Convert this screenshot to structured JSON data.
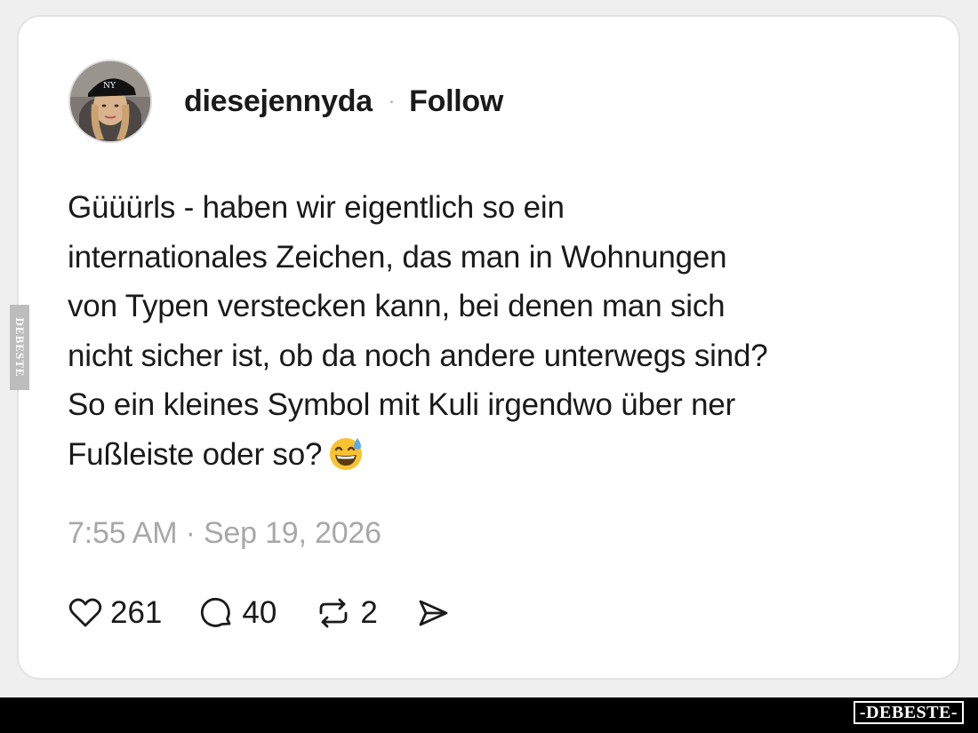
{
  "post": {
    "username": "diesejennyda",
    "separator": "·",
    "follow_label": "Follow",
    "text_lines": [
      "Güüürls - haben wir eigentlich so ein",
      "internationales Zeichen, das man in Wohnungen",
      "von Typen verstecken kann, bei denen man sich",
      "nicht sicher ist, ob da noch andere unterwegs sind?",
      "So ein kleines Symbol mit Kuli irgendwo über ner",
      "Fußleiste oder so?"
    ],
    "emoji": "grinning-face-with-sweat",
    "timestamp": "7:55 AM · Sep 19, 2026",
    "likes": "261",
    "comments": "40",
    "reposts": "2"
  },
  "icons": {
    "like": "heart-icon",
    "comment": "comment-bubble-icon",
    "repost": "repost-icon",
    "share": "send-icon"
  },
  "watermark": {
    "bottom": "-DEBESTE-",
    "side": "DEBESTE"
  },
  "colors": {
    "text": "#1a1a1a",
    "muted": "#a8a8a8",
    "background": "#efefef",
    "card": "#ffffff"
  }
}
